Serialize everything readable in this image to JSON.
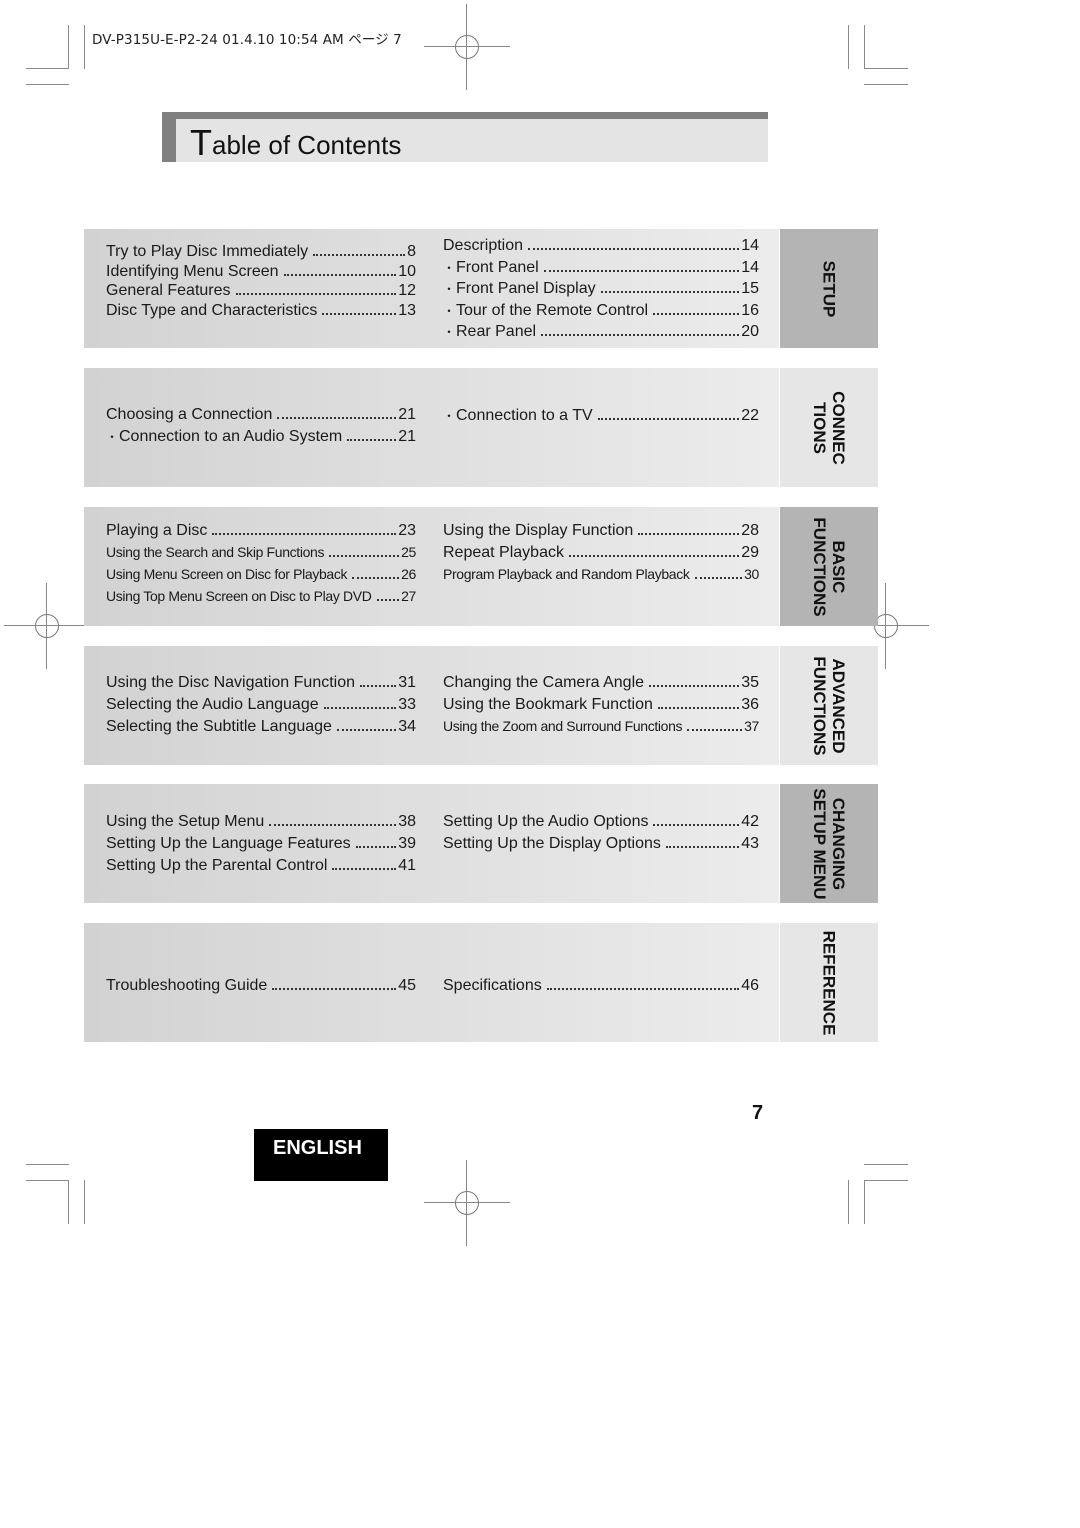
{
  "print_slug": "DV-P315U-E-P2-24  01.4.10 10:54 AM  ページ 7",
  "title": {
    "initial": "T",
    "rest": "able of Contents"
  },
  "sections": [
    {
      "tab": [
        "SETUP"
      ],
      "tab_style": "dark",
      "left": [
        {
          "text": "Try to Play Disc Immediately",
          "page": "8",
          "bullet": false
        },
        {
          "text": "Identifying Menu Screen",
          "page": "10",
          "bullet": false
        },
        {
          "text": "General Features",
          "page": "12",
          "bullet": false
        },
        {
          "text": "Disc Type and Characteristics",
          "page": "13",
          "bullet": false
        }
      ],
      "right": [
        {
          "text": "Description",
          "page": "14",
          "bullet": false
        },
        {
          "text": "Front Panel",
          "page": "14",
          "bullet": true
        },
        {
          "text": "Front Panel Display",
          "page": "15",
          "bullet": true
        },
        {
          "text": "Tour of the Remote Control",
          "page": "16",
          "bullet": true
        },
        {
          "text": "Rear Panel",
          "page": "20",
          "bullet": true
        }
      ]
    },
    {
      "tab": [
        "CONNEC",
        "TIONS"
      ],
      "tab_style": "light",
      "left": [
        {
          "text": "Choosing a Connection",
          "page": "21",
          "bullet": false
        },
        {
          "text": "Connection to an Audio System",
          "page": "21",
          "bullet": true
        }
      ],
      "right": [
        {
          "text": "Connection to a TV",
          "page": "22",
          "bullet": true
        }
      ]
    },
    {
      "tab": [
        "BASIC",
        "FUNCTIONS"
      ],
      "tab_style": "dark",
      "left": [
        {
          "text": "Playing a Disc",
          "page": "23",
          "bullet": false
        },
        {
          "text": "Using the Search and Skip Functions",
          "page": "25",
          "bullet": false
        },
        {
          "text": "Using Menu Screen on Disc for Playback",
          "page": "26",
          "bullet": false
        },
        {
          "text": "Using Top Menu Screen on Disc to Play DVD",
          "page": "27",
          "bullet": false
        }
      ],
      "right": [
        {
          "text": "Using the Display Function",
          "page": "28",
          "bullet": false
        },
        {
          "text": "Repeat Playback",
          "page": "29",
          "bullet": false
        },
        {
          "text": "Program Playback and Random Playback",
          "page": "30",
          "bullet": false
        }
      ]
    },
    {
      "tab": [
        "ADVANCED",
        "FUNCTIONS"
      ],
      "tab_style": "light",
      "left": [
        {
          "text": "Using the Disc Navigation Function",
          "page": "31",
          "bullet": false
        },
        {
          "text": "Selecting the Audio Language",
          "page": "33",
          "bullet": false
        },
        {
          "text": "Selecting the Subtitle Language",
          "page": "34",
          "bullet": false
        }
      ],
      "right": [
        {
          "text": "Changing the Camera Angle",
          "page": "35",
          "bullet": false
        },
        {
          "text": "Using the Bookmark Function",
          "page": "36",
          "bullet": false
        },
        {
          "text": "Using the Zoom and Surround Functions",
          "page": "37",
          "bullet": false
        }
      ]
    },
    {
      "tab": [
        "CHANGING",
        "SETUP MENU"
      ],
      "tab_style": "dark",
      "left": [
        {
          "text": "Using the Setup Menu",
          "page": "38",
          "bullet": false
        },
        {
          "text": "Setting Up the Language Features",
          "page": "39",
          "bullet": false
        },
        {
          "text": "Setting Up the Parental Control",
          "page": "41",
          "bullet": false
        }
      ],
      "right": [
        {
          "text": "Setting Up the Audio Options",
          "page": "42",
          "bullet": false
        },
        {
          "text": "Setting Up the Display Options",
          "page": "43",
          "bullet": false
        }
      ]
    },
    {
      "tab": [
        "REFERENCE"
      ],
      "tab_style": "light",
      "left": [
        {
          "text": "Troubleshooting Guide",
          "page": "45",
          "bullet": false
        }
      ],
      "right": [
        {
          "text": "Specifications",
          "page": "46",
          "bullet": false
        }
      ]
    }
  ],
  "page_number": "7",
  "language_badge": "ENGLISH",
  "bullet_glyph": "・"
}
